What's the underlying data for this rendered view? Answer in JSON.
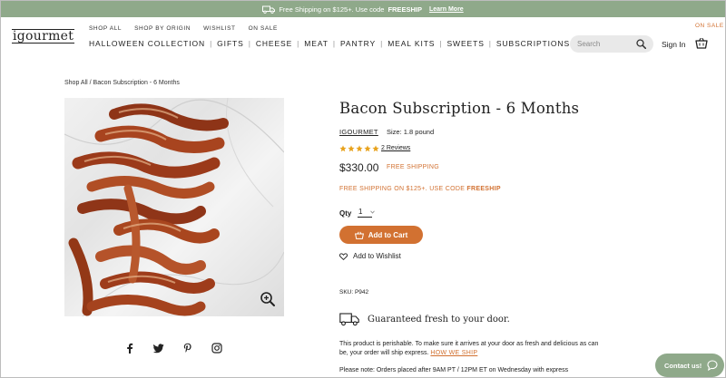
{
  "promo": {
    "text": "Free Shipping on $125+. Use code",
    "code": "FREESHIP",
    "learn_more": "Learn More"
  },
  "header": {
    "logo": "igourmet",
    "top_links": [
      "SHOP ALL",
      "SHOP BY ORIGIN",
      "WISHLIST",
      "ON SALE"
    ],
    "main_nav": [
      "HALLOWEEN COLLECTION",
      "GIFTS",
      "CHEESE",
      "MEAT",
      "PANTRY",
      "MEAL KITS",
      "SWEETS",
      "SUBSCRIPTIONS"
    ],
    "on_sale_tag": "ON SALE",
    "search_placeholder": "Search",
    "sign_in": "Sign In"
  },
  "breadcrumb": {
    "root": "Shop All",
    "sep": " / ",
    "current": "Bacon Subscription - 6 Months"
  },
  "product": {
    "title": "Bacon Subscription - 6 Months",
    "brand": "IGOURMET",
    "size": "Size: 1.8 pound",
    "rating": 5,
    "reviews": "2 Reviews",
    "price": "$330.00",
    "free_shipping": "FREE SHIPPING",
    "promo_line_prefix": "FREE SHIPPING ON $125+. USE CODE ",
    "promo_line_code": "FREESHIP",
    "qty_label": "Qty",
    "qty_value": "1",
    "add_to_cart": "Add to Cart",
    "wishlist": "Add to Wishlist",
    "sku": "SKU: P942",
    "fresh_heading": "Guaranteed fresh to your door.",
    "perishable_text": "This product is perishable. To make sure it arrives at your door as fresh and delicious as can be, your order will ship express.",
    "how_we_ship": "HOW WE SHIP",
    "note": "Please note: Orders placed after 9AM PT / 12PM ET on Wednesday with express"
  },
  "contact": "Contact us!",
  "colors": {
    "accent": "#d27131",
    "promo_bar": "#8fa98a",
    "star": "#e8a21c"
  }
}
